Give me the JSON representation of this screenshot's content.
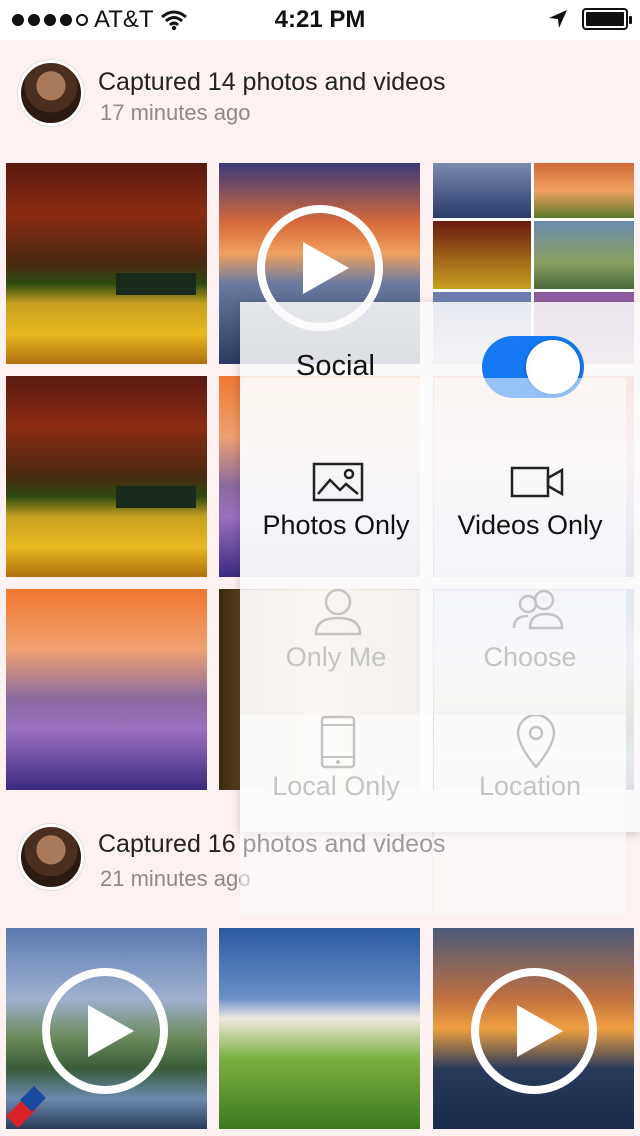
{
  "status_bar": {
    "carrier": "AT&T",
    "time": "4:21 PM",
    "signal_bars_filled": 4,
    "signal_bars_total": 5
  },
  "posts": [
    {
      "title": "Captured 14 photos and videos",
      "time_ago": "17 minutes ago"
    },
    {
      "title": "Captured 16 photos and videos",
      "time_ago": "21 minutes ago"
    }
  ],
  "menu": {
    "social_label": "Social",
    "social_enabled": true,
    "items": [
      {
        "label": "Photos Only",
        "icon": "image-icon",
        "enabled": true
      },
      {
        "label": "Videos Only",
        "icon": "video-camera-icon",
        "enabled": true
      },
      {
        "label": "Only Me",
        "icon": "person-icon",
        "enabled": false
      },
      {
        "label": "Choose",
        "icon": "people-icon",
        "enabled": false
      },
      {
        "label": "Local Only",
        "icon": "phone-icon",
        "enabled": false
      },
      {
        "label": "Location",
        "icon": "location-pin-icon",
        "enabled": false
      }
    ]
  },
  "colors": {
    "toggle_on": "#1479f2",
    "feed_background": "#fdf1f1",
    "disabled_text": "#c4c4c4"
  }
}
